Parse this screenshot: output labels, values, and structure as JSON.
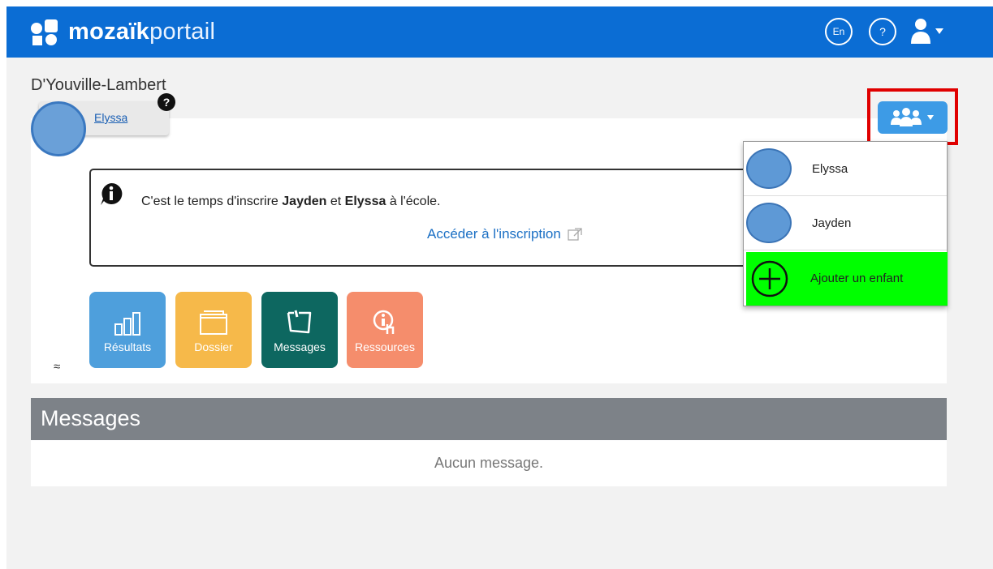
{
  "header": {
    "brand_bold": "mozaïk",
    "brand_light": "portail",
    "lang_label": "En",
    "help_label": "?"
  },
  "school": {
    "name": "D'Youville-Lambert"
  },
  "child_tab": {
    "name": "Elyssa",
    "help": "?"
  },
  "info": {
    "prefix": "C'est le temps d'inscrire ",
    "child1": "Jayden",
    "middle": " et ",
    "child2": "Elyssa",
    "suffix": " à l'école.",
    "link": "Accéder à l'inscription"
  },
  "tiles": [
    {
      "label": "Résultats"
    },
    {
      "label": "Dossier"
    },
    {
      "label": "Messages"
    },
    {
      "label": "Ressources"
    }
  ],
  "collapse": "≈",
  "messages": {
    "title": "Messages",
    "empty": "Aucun message."
  },
  "dropdown": {
    "items": [
      {
        "name": "Elyssa"
      },
      {
        "name": "Jayden"
      }
    ],
    "add_label": "Ajouter un enfant"
  },
  "colors": {
    "brand_blue": "#0b6dd4",
    "highlight_red": "#e00000",
    "add_green": "#00ff00"
  }
}
